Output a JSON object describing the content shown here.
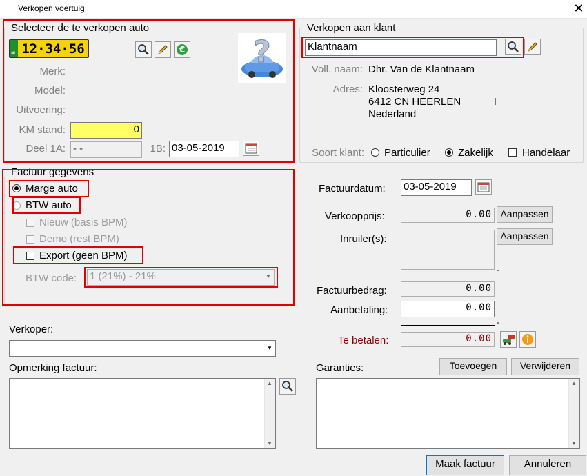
{
  "window": {
    "title": "Verkopen voertuig",
    "close_glyph": "✕"
  },
  "vehicle": {
    "legend": "Selecteer de te verkopen auto",
    "plate_country": "NL",
    "plate": "12·34·56",
    "labels": {
      "merk": "Merk:",
      "model": "Model:",
      "uitvoering": "Uitvoering:",
      "km": "KM stand:",
      "deel1a": "Deel 1A:",
      "deel1b": "1B:"
    },
    "km_value": "0",
    "deel1a_value": "-  -",
    "deel1b_value": "03-05-2019",
    "icons": [
      "magnifier-icon",
      "pencil-icon",
      "euro-icon",
      "car-question-icon"
    ]
  },
  "customer": {
    "legend": "Verkopen aan klant",
    "search_value": "Klantnaam",
    "full_name_label": "Voll. naam:",
    "full_name": "Dhr. Van de Klantnaam",
    "address_label": "Adres:",
    "address_lines": [
      "Kloosterweg 24",
      "6412 CN HEERLEN",
      "Nederland"
    ],
    "type_label": "Soort klant:",
    "types": [
      "Particulier",
      "Zakelijk",
      "Handelaar"
    ],
    "selected_type": "Zakelijk"
  },
  "invoice": {
    "legend": "Factuur gegevens",
    "marge": "Marge auto",
    "btw": "BTW auto",
    "nieuw": "Nieuw (basis BPM)",
    "demo": "Demo (rest BPM)",
    "export": "Export (geen BPM)",
    "btw_code_label": "BTW code:",
    "btw_code_value": "1 (21%) - 21%",
    "factuurdatum_label": "Factuurdatum:",
    "factuurdatum": "03-05-2019",
    "verkoopprijs_label": "Verkoopprijs:",
    "verkoopprijs": "0.00",
    "inruiler_label": "Inruiler(s):",
    "aanpassen": "Aanpassen",
    "factuurbedrag_label": "Factuurbedrag:",
    "factuurbedrag": "0.00",
    "aanbetaling_label": "Aanbetaling:",
    "aanbetaling": "0.00",
    "te_betalen_label": "Te betalen:",
    "te_betalen": "0.00",
    "dash": "-"
  },
  "seller": {
    "label": "Verkoper:",
    "value": ""
  },
  "remarks": {
    "label": "Opmerking factuur:"
  },
  "warranties": {
    "label": "Garanties:",
    "add": "Toevoegen",
    "remove": "Verwijderen"
  },
  "footer": {
    "make_invoice": "Maak factuur",
    "cancel": "Annuleren"
  },
  "colors": {
    "red_highlight": "#e00000",
    "te_betalen": "#8b0000",
    "km_bg": "#ffff66",
    "plate_bg": "#f5d20a"
  }
}
